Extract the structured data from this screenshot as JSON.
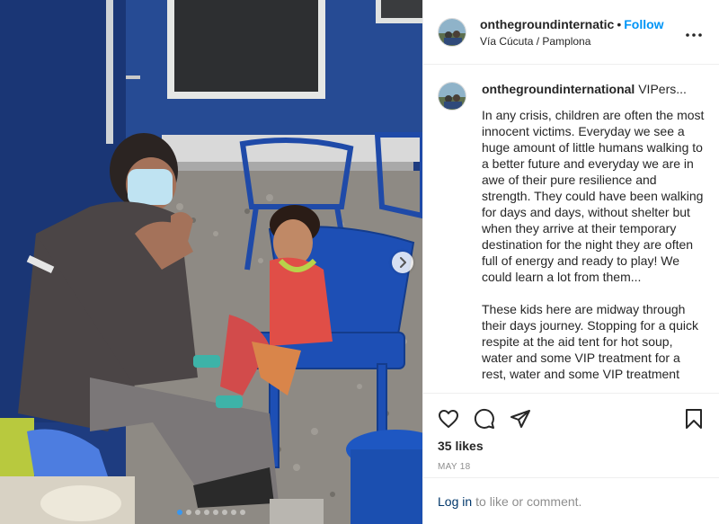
{
  "header": {
    "username": "onthegroundinternatic",
    "separator": "•",
    "follow_label": "Follow",
    "location": "Vía Cúcuta / Pamplona",
    "more_icon": "more-horizontal-icon"
  },
  "caption": {
    "username": "onthegroundinternational",
    "truncated_title": "VIPers...",
    "paragraphs": [
      "In any crisis, children are often the most innocent victims. Everyday we see a huge amount of little humans walking to a better future and everyday we are in awe of their pure resilience and strength. They could have been walking for days and days, without shelter but when they arrive at their temporary destination for the night they are often full of energy and ready to play! We could learn a lot from them...",
      "These kids here are midway through their days journey. Stopping for a quick respite at the aid tent for hot soup, water and some VIP treatment for a rest, water and some VIP treatment"
    ]
  },
  "actions": {
    "like_icon": "heart-icon",
    "comment_icon": "comment-icon",
    "share_icon": "share-icon",
    "save_icon": "bookmark-icon",
    "likes": "35 likes",
    "date": "MAY 18"
  },
  "login": {
    "link": "Log in",
    "rest": "to like or comment."
  },
  "carousel": {
    "slides": 8,
    "active_index": 0,
    "next_icon": "chevron-right-icon"
  },
  "colors": {
    "link_blue": "#0095f6",
    "tent_blue": "#1f3f86",
    "active_dot": "#3897f0"
  }
}
